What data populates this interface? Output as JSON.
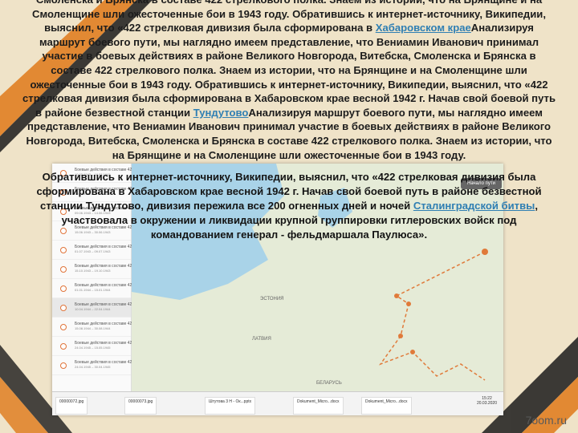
{
  "slide": {
    "para1_a": "Смоленска и Брянска в составе 422 стрелкового полка. Знаем из истории, что на Брянщине и на Смоленщине шли ожесточенные бои в 1943 году. Обратившись к интернет-источнику, Википедии, выяснил, что «422 стрелковая дивизия была сформирована в ",
    "link1": "Хабаровском крае",
    "para1_b": "Анализируя маршрут боевого пути, мы наглядно имеем представление, что Вениамин Иванович принимал участие в боевых действиях в районе Великого Новгорода, Витебска, Смоленска и Брянска в составе 422 стрелкового полка. Знаем из истории, что на Брянщине и на Смоленщине шли ожесточенные бои в 1943 году. Обратившись к интернет-источнику, Википедии, выяснил, что «422 стрелковая дивизия была сформирована в Хабаровском крае весной 1942 г. Начав свой боевой путь в районе безвестной станции ",
    "link2": "Тундутово",
    "para1_c": "Анализируя маршрут боевого пути, мы наглядно имеем представление, что Вениамин Иванович принимал участие в боевых действиях в районе Великого Новгорода, Витебска, Смоленска и Брянска в составе 422 стрелкового полка. Знаем из истории, что на Брянщине и на Смоленщине шли ожесточенные бои в 1943 году.",
    "para2_a": "Обратившись к интернет-источнику, Википедии, выяснил, что «422 стрелковая дивизия была сформирована в Хабаровском крае весной 1942 г. Начав свой боевой путь в районе безвестной станции Тундутово, дивизия пережила все 200 огненных дней и ночей ",
    "link3": "Сталинградской битвы",
    "para2_b": ", участвовала в окружении и ликвидации крупной группировки гитлеровских войск под командованием генерал - фельдмаршала Паулюса».",
    "watermark": "7oom.ru"
  },
  "screenshot": {
    "route_button": "Начало пути",
    "sidebar_items": [
      {
        "label": "Боевые действия в составе 422 ст",
        "date": "10.03.1943 – 18.03.1943"
      },
      {
        "label": "Боевые действия в составе 422 ст",
        "date": "19.03.1943 – 27.03.1943"
      },
      {
        "label": "Боевые действия в составе 422 ст",
        "date": "09.06.1943 – 14.06.1943"
      },
      {
        "label": "Боевые действия в составе 422 ст",
        "date": "15.06.1943 – 30.06.1943"
      },
      {
        "label": "Боевые действия в составе 422 ст",
        "date": "01.07.1943 – 09.07.1943"
      },
      {
        "label": "Боевые действия в составе 422 ст",
        "date": "15.10.1943 – 19.10.1943"
      },
      {
        "label": "Боевые действия в составе 422 ст",
        "date": "01.01.1944 – 15.01.1944"
      },
      {
        "label": "Боевые действия в составе 422 ст",
        "date": "10.04.1944 – 22.04.1944"
      },
      {
        "label": "Боевые действия в составе 422 ст",
        "date": "15.08.1944 – 30.08.1944"
      },
      {
        "label": "Боевые действия в составе 422 ст",
        "date": "24.04.1945 – 15.05.1945"
      },
      {
        "label": "Боевые действия в составе 422 ст",
        "date": "24.04.1945 – 30.04.1945"
      }
    ],
    "map_labels": {
      "estonia": "ЭСТОНИЯ",
      "latvia": "ЛАТВИЯ",
      "belarus": "БЕЛАРУСЬ"
    },
    "taskbar": [
      "00000072.jpg",
      "00000073.jpg",
      "Штутова 3 Н - Ок...ррtx",
      "Dokument_Micro...docx",
      "Dokument_Micro...docx"
    ],
    "clock_time": "15:22",
    "clock_date": "20.03.2020"
  }
}
